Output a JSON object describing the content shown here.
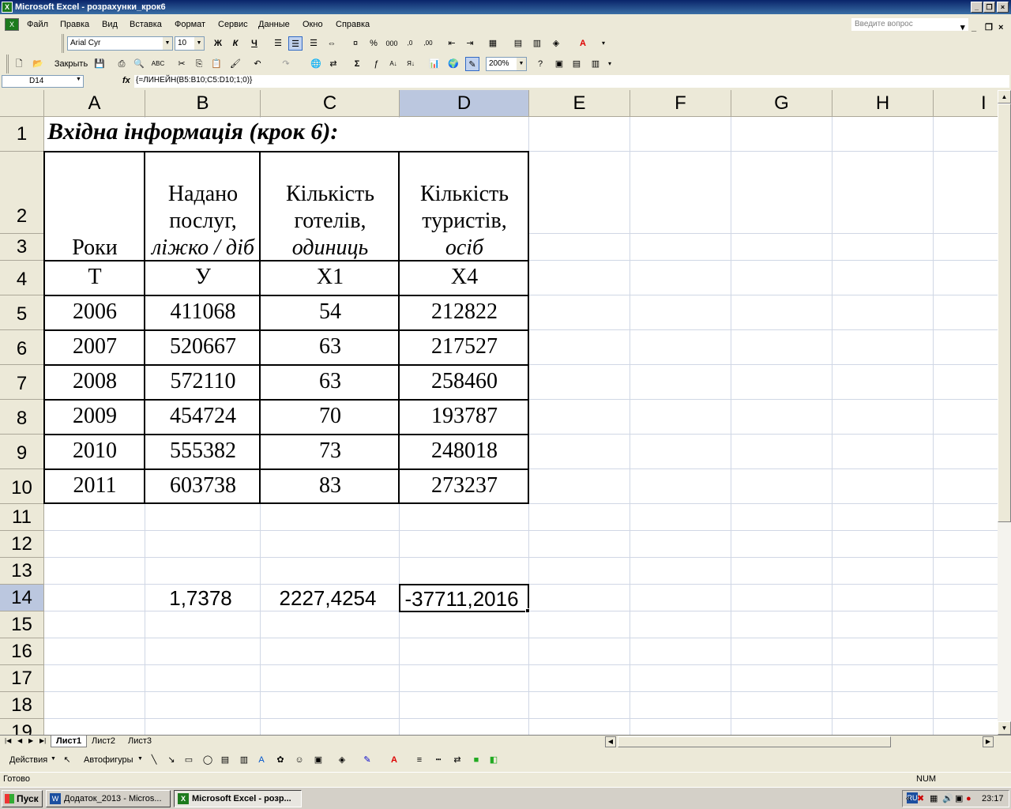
{
  "window": {
    "title": "Microsoft Excel - розрахунки_крок6",
    "app_icon": "X"
  },
  "menu": {
    "items": [
      "Файл",
      "Правка",
      "Вид",
      "Вставка",
      "Формат",
      "Сервис",
      "Данные",
      "Окно",
      "Справка"
    ],
    "help_placeholder": "Введите вопрос"
  },
  "toolbar_format": {
    "font_name": "Arial Cyr",
    "font_size": "10",
    "bold": "Ж",
    "italic": "К",
    "underline": "Ч"
  },
  "toolbar_standard": {
    "close_label": "Закрыть",
    "zoom": "200%"
  },
  "formula_bar": {
    "name_box": "D14",
    "fx": "fx",
    "formula": "{=ЛИНЕЙН(B5:B10;C5:D10;1;0)}"
  },
  "columns": [
    "A",
    "B",
    "C",
    "D",
    "E",
    "F",
    "G",
    "H",
    "I"
  ],
  "rows": [
    "1",
    "2",
    "3",
    "4",
    "5",
    "6",
    "7",
    "8",
    "9",
    "10",
    "11",
    "12",
    "13",
    "14",
    "15",
    "16",
    "17",
    "18",
    "19"
  ],
  "sheet": {
    "title": "Вхідна інформація (крок 6):",
    "header": {
      "a": "Роки",
      "b_line1": "Надано",
      "b_line2": "послуг,",
      "b_line3": "ліжко / діб",
      "c_line1": "Кількість",
      "c_line2": "готелів,",
      "c_line3": "одиниць",
      "d_line1": "Кількість",
      "d_line2": "туристів,",
      "d_line3": "осіб"
    },
    "symbols": [
      "T",
      "У",
      "X1",
      "X4"
    ],
    "data_rows": [
      [
        "2006",
        "411068",
        "54",
        "212822"
      ],
      [
        "2007",
        "520667",
        "63",
        "217527"
      ],
      [
        "2008",
        "572110",
        "63",
        "258460"
      ],
      [
        "2009",
        "454724",
        "70",
        "193787"
      ],
      [
        "2010",
        "555382",
        "73",
        "248018"
      ],
      [
        "2011",
        "603738",
        "83",
        "273237"
      ]
    ],
    "results": [
      "1,7378",
      "2227,4254",
      "-37711,2016"
    ]
  },
  "tabs": [
    "Лист1",
    "Лист2",
    "Лист3"
  ],
  "drawing": {
    "actions": "Действия",
    "autoshapes": "Автофигуры"
  },
  "status": {
    "left": "Готово",
    "num": "NUM"
  },
  "taskbar": {
    "start": "Пуск",
    "task1": "Додаток_2013 - Micros...",
    "task2": "Microsoft Excel - розр...",
    "lang": "RU",
    "time": "23:17"
  }
}
